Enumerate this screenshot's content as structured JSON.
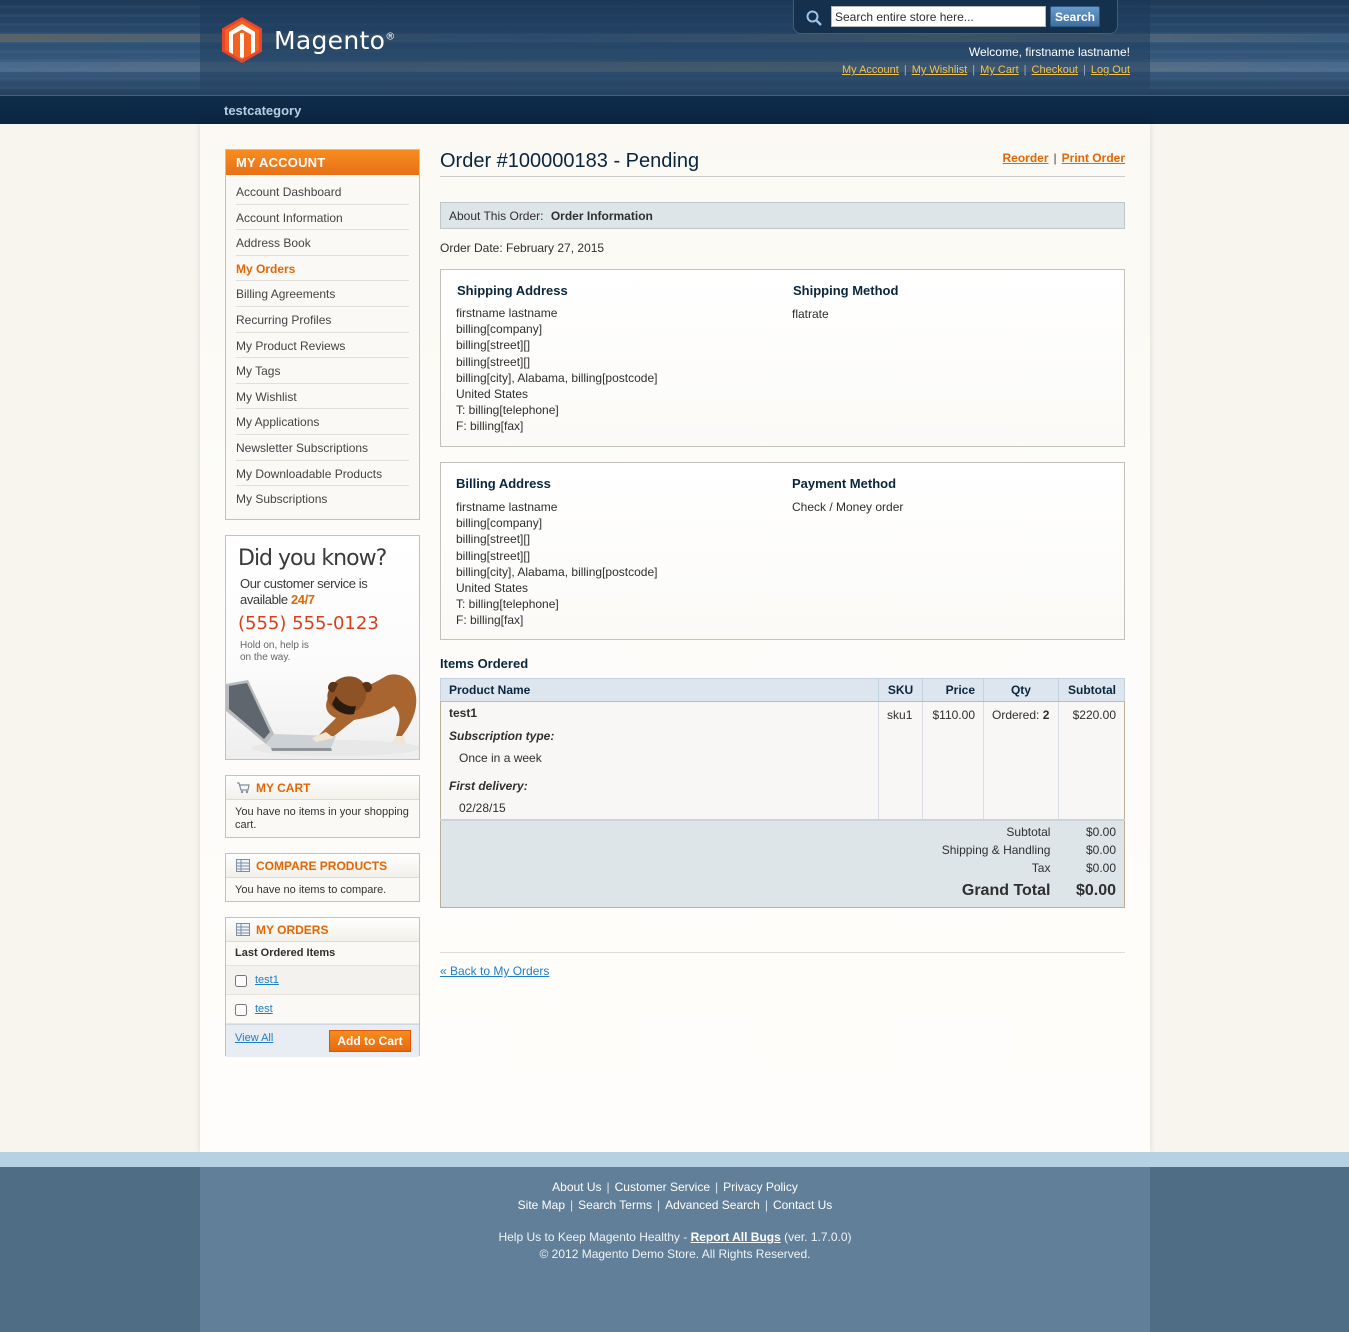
{
  "header": {
    "logo_text": "Magento",
    "logo_reg": "®",
    "search": {
      "placeholder": "Search entire store here...",
      "value": "Search entire store here...",
      "button": "Search"
    },
    "welcome": "Welcome, firstname lastname!",
    "top_links": [
      "My Account",
      "My Wishlist",
      "My Cart",
      "Checkout",
      "Log Out"
    ],
    "nav": [
      "testcategory"
    ]
  },
  "sidebar": {
    "account": {
      "title": "MY ACCOUNT",
      "items": [
        "Account Dashboard",
        "Account Information",
        "Address Book",
        "My Orders",
        "Billing Agreements",
        "Recurring Profiles",
        "My Product Reviews",
        "My Tags",
        "My Wishlist",
        "My Applications",
        "Newsletter Subscriptions",
        "My Downloadable Products",
        "My Subscriptions"
      ],
      "current": "My Orders"
    },
    "banner": {
      "headline": "Did you know?",
      "line1": "Our customer service is",
      "line2": "available",
      "highlight": "24/7",
      "phone": "(555) 555-0123",
      "hold1": "Hold on, help is",
      "hold2": "on the way."
    },
    "cart": {
      "title": "MY CART",
      "text": "You have no items in your shopping cart."
    },
    "compare": {
      "title": "COMPARE PRODUCTS",
      "text": "You have no items to compare."
    },
    "orders": {
      "title": "MY ORDERS",
      "subtitle": "Last Ordered Items",
      "items": [
        "test1",
        "test"
      ],
      "view_all": "View All",
      "add_to_cart": "Add to Cart"
    }
  },
  "order": {
    "title": "Order #100000183 - Pending",
    "actions": [
      "Reorder",
      "Print Order"
    ],
    "about_label": "About This Order:",
    "about_value": "Order Information",
    "date": "Order Date: February 27, 2015",
    "shipping_address": {
      "title": "Shipping Address",
      "lines": [
        "firstname lastname",
        "billing[company]",
        "billing[street][]",
        "billing[street][]",
        "billing[city], Alabama, billing[postcode]",
        "United States",
        "T: billing[telephone]",
        "F: billing[fax]"
      ]
    },
    "shipping_method": {
      "title": "Shipping Method",
      "value": "flatrate"
    },
    "billing_address": {
      "title": "Billing Address",
      "lines": [
        "firstname lastname",
        "billing[company]",
        "billing[street][]",
        "billing[street][]",
        "billing[city], Alabama, billing[postcode]",
        "United States",
        "T: billing[telephone]",
        "F: billing[fax]"
      ]
    },
    "payment_method": {
      "title": "Payment Method",
      "value": "Check / Money order"
    },
    "items_title": "Items Ordered",
    "columns": [
      "Product Name",
      "SKU",
      "Price",
      "Qty",
      "Subtotal"
    ],
    "items": [
      {
        "name": "test1",
        "option1_label": "Subscription type:",
        "option1_value": "Once in a week",
        "option2_label": "First delivery:",
        "option2_value": "02/28/15",
        "sku": "sku1",
        "price": "$110.00",
        "qty_label": "Ordered:",
        "qty": "2",
        "subtotal": "$220.00"
      }
    ],
    "totals": {
      "subtotal_label": "Subtotal",
      "subtotal": "$0.00",
      "shipping_label": "Shipping & Handling",
      "shipping": "$0.00",
      "tax_label": "Tax",
      "tax": "$0.00",
      "grand_label": "Grand Total",
      "grand": "$0.00"
    },
    "back_link": "« Back to My Orders"
  },
  "footer": {
    "links_row1": [
      "About Us",
      "Customer Service",
      "Privacy Policy"
    ],
    "links_row2": [
      "Site Map",
      "Search Terms",
      "Advanced Search",
      "Contact Us"
    ],
    "help_text": "Help Us to Keep Magento Healthy - ",
    "help_link": "Report All Bugs",
    "version": " (ver. 1.7.0.0)",
    "copyright": "© 2012 Magento Demo Store. All Rights Reserved."
  },
  "colors": {
    "accent": "#e26703",
    "link": "#1e7ec8",
    "header": "#1d3a58",
    "title": "#0a263c"
  }
}
